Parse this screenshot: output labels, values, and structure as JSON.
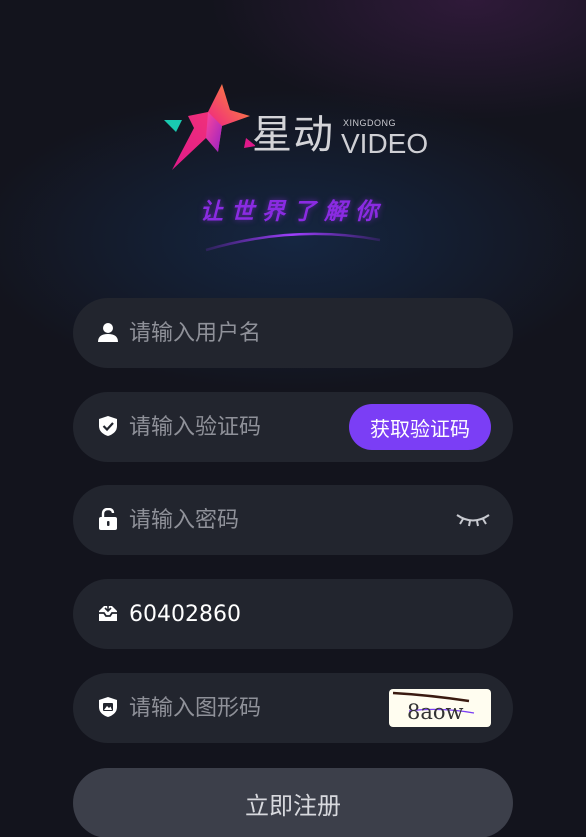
{
  "brand": {
    "name_cn": "星动",
    "name_small": "XINGDONG",
    "name_en": "VIDEO",
    "slogan": "让世界了解你",
    "colors": {
      "accent": "#7b3ef5",
      "logo_gradient_start": "#ff8a2b",
      "logo_gradient_end": "#e0198a",
      "logo_teal": "#19c9b0",
      "slogan": "#8a2be2"
    }
  },
  "form": {
    "username": {
      "icon": "user-icon",
      "placeholder": "请输入用户名",
      "value": ""
    },
    "verify_code": {
      "icon": "shield-check-icon",
      "placeholder": "请输入验证码",
      "value": "",
      "button_label": "获取验证码"
    },
    "password": {
      "icon": "unlock-icon",
      "placeholder": "请输入密码",
      "value": "",
      "toggle_icon": "eye-closed-icon"
    },
    "invite": {
      "icon": "inbox-icon",
      "placeholder": "",
      "value": "60402860"
    },
    "captcha": {
      "icon": "image-shield-icon",
      "placeholder": "请输入图形码",
      "value": "",
      "image_text": "8aow"
    },
    "submit_label": "立即注册"
  }
}
